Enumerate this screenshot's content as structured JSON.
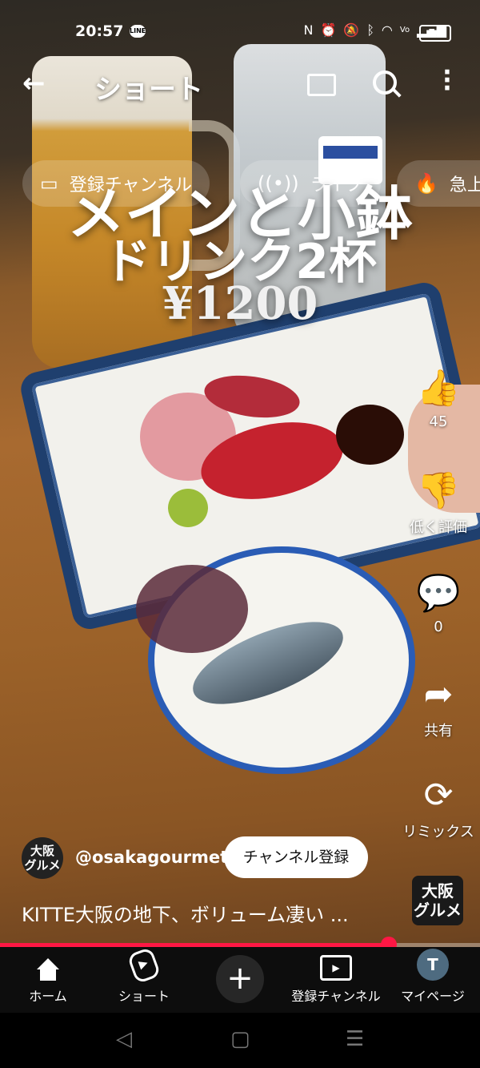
{
  "status_bar": {
    "time": "20:57",
    "line_badge": "LINE",
    "icons": [
      "nfc-icon",
      "alarm-icon",
      "mute-icon",
      "bluetooth-icon",
      "wifi-icon",
      "volte-icon",
      "signal-icon"
    ],
    "battery": "74"
  },
  "app_bar": {
    "title": "ショート"
  },
  "chips": [
    {
      "label": "登録チャンネル",
      "icon": "subscriptions-icon"
    },
    {
      "label": "ライブ",
      "icon": "live-icon"
    },
    {
      "label": "急上",
      "icon": "trending-icon"
    }
  ],
  "video_overlay": {
    "line1": "メインと小鉢",
    "line2": "ドリンク2杯",
    "price": "¥1200"
  },
  "actions": {
    "like_count": "45",
    "dislike_label": "低く評価",
    "comment_count": "0",
    "share_label": "共有",
    "remix_label": "リミックス"
  },
  "channel": {
    "avatar_text_1": "大阪",
    "avatar_text_2": "グルメ",
    "handle": "@osakagourmet",
    "subscribe_label": "チャンネル登録"
  },
  "caption": "KITTE大阪の地下、ボリューム凄い ...",
  "corner_logo": {
    "line1": "大阪",
    "line2": "グルメ"
  },
  "playback": {
    "progress": 0.81
  },
  "bottom_nav": {
    "home": "ホーム",
    "shorts": "ショート",
    "add": "+",
    "subscriptions": "登録チャンネル",
    "mypage": "マイページ",
    "mypage_initial": "T"
  },
  "colors": {
    "accent": "#ff1744",
    "nav_bg": "#0d0d0d"
  }
}
